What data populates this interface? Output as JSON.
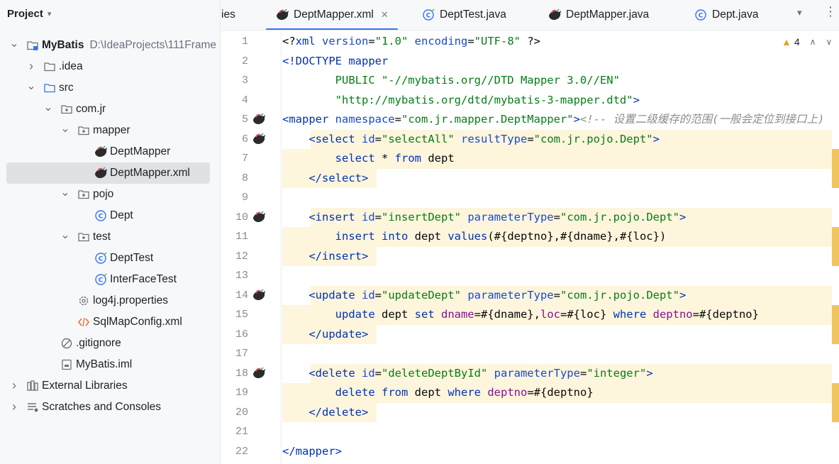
{
  "project_panel": {
    "title": "Project",
    "tree": [
      {
        "name": "MyBatis",
        "path": "D:\\IdeaProjects\\111Frame",
        "bold": true,
        "icon": "module-folder-icon",
        "arrow": "v",
        "indent": 0
      },
      {
        "name": ".idea",
        "icon": "folder-icon",
        "arrow": ">",
        "indent": 1
      },
      {
        "name": "src",
        "icon": "source-folder-icon",
        "arrow": "v",
        "indent": 1
      },
      {
        "name": "com.jr",
        "icon": "package-icon",
        "arrow": "v",
        "indent": 2
      },
      {
        "name": "mapper",
        "icon": "package-icon",
        "arrow": "v",
        "indent": 3
      },
      {
        "name": "DeptMapper",
        "icon": "mybatis-bird-icon",
        "indent": 4
      },
      {
        "name": "DeptMapper.xml",
        "icon": "mybatis-bird-icon",
        "indent": 4,
        "selected": true
      },
      {
        "name": "pojo",
        "icon": "package-icon",
        "arrow": "v",
        "indent": 3
      },
      {
        "name": "Dept",
        "icon": "class-icon",
        "indent": 4
      },
      {
        "name": "test",
        "icon": "package-icon",
        "arrow": "v",
        "indent": 3
      },
      {
        "name": "DeptTest",
        "icon": "test-class-icon",
        "indent": 4
      },
      {
        "name": "InterFaceTest",
        "icon": "test-class-icon",
        "indent": 4
      },
      {
        "name": "log4j.properties",
        "icon": "gear-icon",
        "indent": 3
      },
      {
        "name": "SqlMapConfig.xml",
        "icon": "xml-icon",
        "indent": 3
      },
      {
        "name": ".gitignore",
        "icon": "ignore-icon",
        "indent": 2
      },
      {
        "name": "MyBatis.iml",
        "icon": "iml-file-icon",
        "indent": 2
      },
      {
        "name": "External Libraries",
        "icon": "library-icon",
        "arrow": ">",
        "indent": 0
      },
      {
        "name": "Scratches and Consoles",
        "icon": "scratches-icon",
        "arrow": ">",
        "indent": 0
      }
    ]
  },
  "tabs": {
    "partial_label": "ies",
    "items": [
      {
        "label": "DeptMapper.xml",
        "icon": "mybatis-bird-icon",
        "active": true,
        "closable": true
      },
      {
        "label": "DeptTest.java",
        "icon": "test-class-icon"
      },
      {
        "label": "DeptMapper.java",
        "icon": "mybatis-bird-icon"
      },
      {
        "label": "Dept.java",
        "icon": "class-icon"
      }
    ]
  },
  "inspection": {
    "warning_count": "4"
  },
  "editor": {
    "lines": [
      {
        "n": "1",
        "tokens": [
          [
            "t-plain",
            "<?"
          ],
          [
            "t-tag",
            "xml "
          ],
          [
            "t-attr",
            "version"
          ],
          [
            "t-plain",
            "="
          ],
          [
            "t-val",
            "\"1.0\" "
          ],
          [
            "t-attr",
            "encoding"
          ],
          [
            "t-plain",
            "="
          ],
          [
            "t-val",
            "\"UTF-8\" "
          ],
          [
            "t-plain",
            "?>"
          ]
        ]
      },
      {
        "n": "2",
        "tokens": [
          [
            "t-tag",
            "<!DOCTYPE "
          ],
          [
            "t-tag",
            "mapper"
          ]
        ]
      },
      {
        "n": "3",
        "tokens": [
          [
            "t-plain",
            "        "
          ],
          [
            "t-val",
            "PUBLIC \"-//mybatis.org//DTD Mapper 3.0//EN\""
          ]
        ]
      },
      {
        "n": "4",
        "tokens": [
          [
            "t-plain",
            "        "
          ],
          [
            "t-val",
            "\"http://mybatis.org/dtd/mybatis-3-mapper.dtd\""
          ],
          [
            "t-tag",
            ">"
          ]
        ]
      },
      {
        "n": "5",
        "gutter": true,
        "tokens": [
          [
            "t-tag",
            "<mapper "
          ],
          [
            "t-attr",
            "namespace"
          ],
          [
            "t-plain",
            "="
          ],
          [
            "t-val",
            "\"com.jr.mapper.DeptMapper\""
          ],
          [
            "t-tag",
            ">"
          ],
          [
            "t-cmt",
            "<!-- 设置二级缓存的范围(一般会定位到接口上)"
          ]
        ]
      },
      {
        "n": "6",
        "gutter": true,
        "hl": "tag",
        "tokens": [
          [
            "t-plain",
            "    "
          ],
          [
            "t-tag",
            "<select "
          ],
          [
            "t-attr",
            "id"
          ],
          [
            "t-plain",
            "="
          ],
          [
            "t-val",
            "\"selectAll\" "
          ],
          [
            "t-attr",
            "resultType"
          ],
          [
            "t-plain",
            "="
          ],
          [
            "t-val",
            "\"com.jr.pojo.Dept\""
          ],
          [
            "t-tag",
            ">"
          ]
        ]
      },
      {
        "n": "7",
        "hl": "body",
        "tokens": [
          [
            "t-plain",
            "        "
          ],
          [
            "t-kw",
            "select "
          ],
          [
            "t-plain",
            "* "
          ],
          [
            "t-kw",
            "from "
          ],
          [
            "t-plain",
            "dept"
          ]
        ]
      },
      {
        "n": "8",
        "hl": "close",
        "tokens": [
          [
            "t-plain",
            "    "
          ],
          [
            "t-tag",
            "</select>"
          ]
        ]
      },
      {
        "n": "9",
        "tokens": []
      },
      {
        "n": "10",
        "gutter": true,
        "hl": "tag",
        "tokens": [
          [
            "t-plain",
            "    "
          ],
          [
            "t-tag",
            "<insert "
          ],
          [
            "t-attr",
            "id"
          ],
          [
            "t-plain",
            "="
          ],
          [
            "t-val",
            "\"insertDept\" "
          ],
          [
            "t-attr",
            "parameterType"
          ],
          [
            "t-plain",
            "="
          ],
          [
            "t-val",
            "\"com.jr.pojo.Dept\""
          ],
          [
            "t-tag",
            ">"
          ]
        ]
      },
      {
        "n": "11",
        "hl": "body",
        "tokens": [
          [
            "t-plain",
            "        "
          ],
          [
            "t-kw",
            "insert "
          ],
          [
            "t-kw",
            "into "
          ],
          [
            "t-plain",
            "dept "
          ],
          [
            "t-kw",
            "values"
          ],
          [
            "t-plain",
            "(#{deptno},#{dname},#{loc})"
          ]
        ]
      },
      {
        "n": "12",
        "hl": "close",
        "tokens": [
          [
            "t-plain",
            "    "
          ],
          [
            "t-tag",
            "</insert>"
          ]
        ]
      },
      {
        "n": "13",
        "tokens": []
      },
      {
        "n": "14",
        "gutter": true,
        "hl": "tag",
        "tokens": [
          [
            "t-plain",
            "    "
          ],
          [
            "t-tag",
            "<update "
          ],
          [
            "t-attr",
            "id"
          ],
          [
            "t-plain",
            "="
          ],
          [
            "t-val",
            "\"updateDept\" "
          ],
          [
            "t-attr",
            "parameterType"
          ],
          [
            "t-plain",
            "="
          ],
          [
            "t-val",
            "\"com.jr.pojo.Dept\""
          ],
          [
            "t-tag",
            ">"
          ]
        ]
      },
      {
        "n": "15",
        "hl": "body",
        "tokens": [
          [
            "t-plain",
            "        "
          ],
          [
            "t-kw",
            "update "
          ],
          [
            "t-plain",
            "dept "
          ],
          [
            "t-kw",
            "set "
          ],
          [
            "t-col",
            "dname"
          ],
          [
            "t-plain",
            "=#{dname},"
          ],
          [
            "t-col",
            "loc"
          ],
          [
            "t-plain",
            "=#{loc} "
          ],
          [
            "t-kw",
            "where "
          ],
          [
            "t-col",
            "deptno"
          ],
          [
            "t-plain",
            "=#{deptno}"
          ]
        ]
      },
      {
        "n": "16",
        "hl": "close",
        "tokens": [
          [
            "t-plain",
            "    "
          ],
          [
            "t-tag",
            "</update>"
          ]
        ]
      },
      {
        "n": "17",
        "tokens": []
      },
      {
        "n": "18",
        "gutter": true,
        "hl": "tag",
        "tokens": [
          [
            "t-plain",
            "    "
          ],
          [
            "t-tag",
            "<delete "
          ],
          [
            "t-attr",
            "id"
          ],
          [
            "t-plain",
            "="
          ],
          [
            "t-val",
            "\"deleteDeptById\" "
          ],
          [
            "t-attr",
            "parameterType"
          ],
          [
            "t-plain",
            "="
          ],
          [
            "t-val",
            "\"integer\""
          ],
          [
            "t-tag",
            ">"
          ]
        ]
      },
      {
        "n": "19",
        "hl": "body",
        "tokens": [
          [
            "t-plain",
            "        "
          ],
          [
            "t-kw",
            "delete "
          ],
          [
            "t-kw",
            "from "
          ],
          [
            "t-plain",
            "dept "
          ],
          [
            "t-kw",
            "where "
          ],
          [
            "t-col",
            "deptno"
          ],
          [
            "t-plain",
            "=#{deptno}"
          ]
        ]
      },
      {
        "n": "20",
        "hl": "close",
        "tokens": [
          [
            "t-plain",
            "    "
          ],
          [
            "t-tag",
            "</delete>"
          ]
        ]
      },
      {
        "n": "21",
        "tokens": []
      },
      {
        "n": "22",
        "tokens": [
          [
            "t-tag",
            "</mapper>"
          ]
        ]
      }
    ]
  }
}
